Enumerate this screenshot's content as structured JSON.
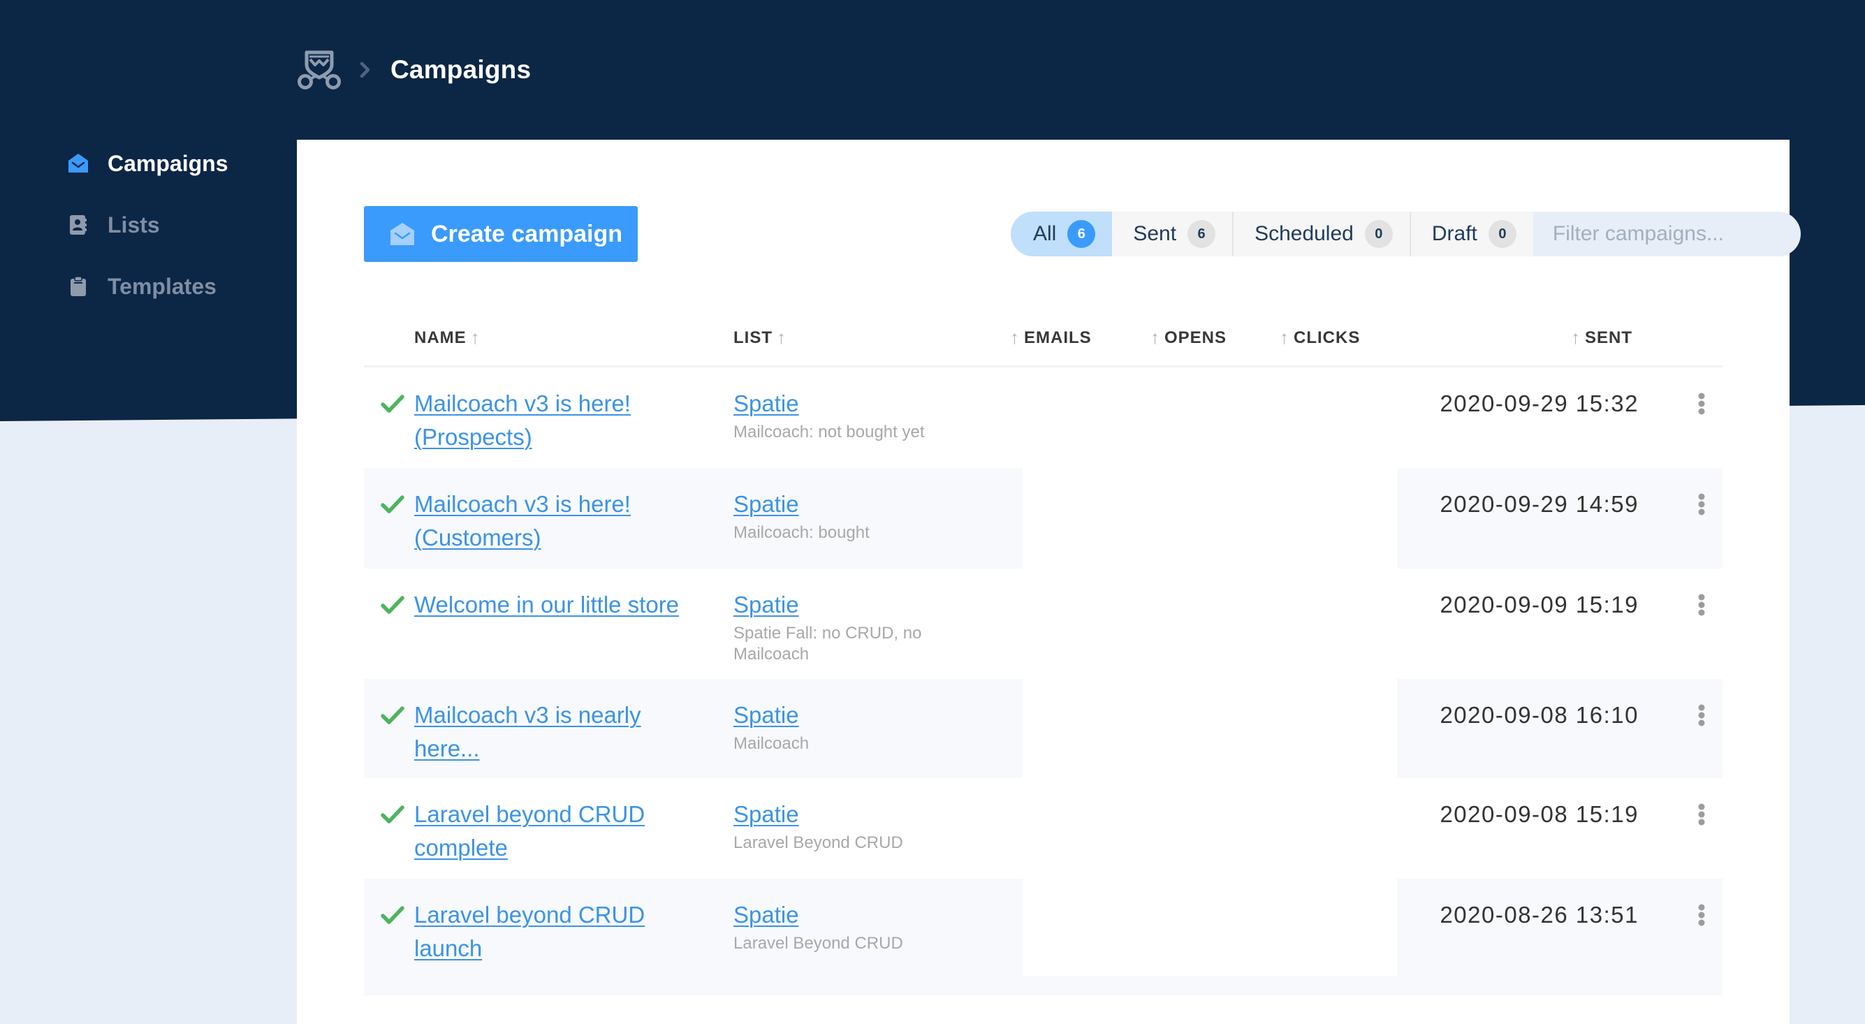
{
  "breadcrumb": {
    "logo_icon": "mailcoach-logo-icon",
    "separator_icon": "chevron-right-icon",
    "current": "Campaigns"
  },
  "sidebar": {
    "items": [
      {
        "label": "Campaigns",
        "icon": "envelope-open-icon",
        "active": true
      },
      {
        "label": "Lists",
        "icon": "address-book-icon",
        "active": false
      },
      {
        "label": "Templates",
        "icon": "clipboard-icon",
        "active": false
      }
    ]
  },
  "toolbar": {
    "create_label": "Create campaign",
    "create_icon": "envelope-open-icon",
    "filters": [
      {
        "label": "All",
        "count": "6",
        "active": true
      },
      {
        "label": "Sent",
        "count": "6",
        "active": false
      },
      {
        "label": "Scheduled",
        "count": "0",
        "active": false
      },
      {
        "label": "Draft",
        "count": "0",
        "active": false
      }
    ],
    "search_placeholder": "Filter campaigns...",
    "search_value": ""
  },
  "table": {
    "columns": {
      "name": "NAME",
      "list": "LIST",
      "emails": "EMAILS",
      "opens": "OPENS",
      "clicks": "CLICKS",
      "sent": "SENT"
    },
    "sort_icon": "arrow-up-icon",
    "rows": [
      {
        "status": "sent",
        "name": "Mailcoach v3 is here! (Prospects)",
        "list": "Spatie",
        "segment": "Mailcoach: not bought yet",
        "emails": "",
        "opens": "",
        "clicks": "",
        "sent": "2020-09-29 15:32"
      },
      {
        "status": "sent",
        "name": "Mailcoach v3 is here! (Customers)",
        "list": "Spatie",
        "segment": "Mailcoach: bought",
        "emails": "",
        "opens": "",
        "clicks": "",
        "sent": "2020-09-29 14:59"
      },
      {
        "status": "sent",
        "name": "Welcome in our little store",
        "list": "Spatie",
        "segment": "Spatie Fall: no CRUD, no Mailcoach",
        "emails": "",
        "opens": "",
        "clicks": "",
        "sent": "2020-09-09 15:19"
      },
      {
        "status": "sent",
        "name": "Mailcoach v3 is nearly here...",
        "list": "Spatie",
        "segment": "Mailcoach",
        "emails": "",
        "opens": "",
        "clicks": "",
        "sent": "2020-09-08 16:10"
      },
      {
        "status": "sent",
        "name": "Laravel beyond CRUD complete",
        "list": "Spatie",
        "segment": "Laravel Beyond CRUD",
        "emails": "",
        "opens": "",
        "clicks": "",
        "sent": "2020-09-08 15:19"
      },
      {
        "status": "sent",
        "name": "Laravel beyond CRUD launch",
        "list": "Spatie",
        "segment": "Laravel Beyond CRUD",
        "emails": "",
        "opens": "",
        "clicks": "",
        "sent": "2020-08-26 13:51"
      }
    ]
  },
  "colors": {
    "header_bg": "#0c2646",
    "page_bg": "#e8eef7",
    "accent": "#3a9bfc",
    "link": "#3b93e6",
    "success": "#4cb45f",
    "muted_nav": "#7f8ea3"
  }
}
